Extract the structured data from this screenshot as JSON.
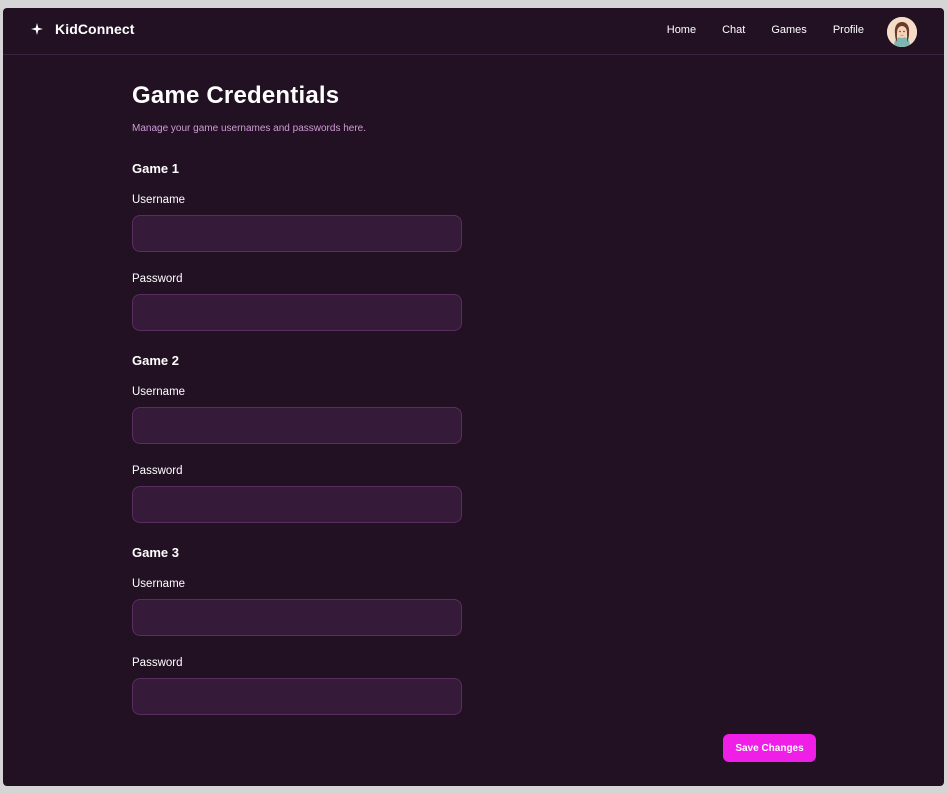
{
  "app": {
    "name": "KidConnect",
    "brand_icon": "sparkle-icon"
  },
  "nav": {
    "items": [
      {
        "label": "Home"
      },
      {
        "label": "Chat"
      },
      {
        "label": "Games"
      },
      {
        "label": "Profile"
      }
    ]
  },
  "page": {
    "title": "Game Credentials",
    "subtitle": "Manage your game usernames and passwords here."
  },
  "games": [
    {
      "title": "Game 1",
      "username_label": "Username",
      "username_value": "",
      "password_label": "Password",
      "password_value": ""
    },
    {
      "title": "Game 2",
      "username_label": "Username",
      "username_value": "",
      "password_label": "Password",
      "password_value": ""
    },
    {
      "title": "Game 3",
      "username_label": "Username",
      "username_value": "",
      "password_label": "Password",
      "password_value": ""
    }
  ],
  "actions": {
    "save_label": "Save Changes"
  },
  "colors": {
    "background": "#211122",
    "input_background": "#361a39",
    "input_border": "#5a2c5f",
    "subtitle": "#d19ad8",
    "accent": "#f01fe8"
  }
}
